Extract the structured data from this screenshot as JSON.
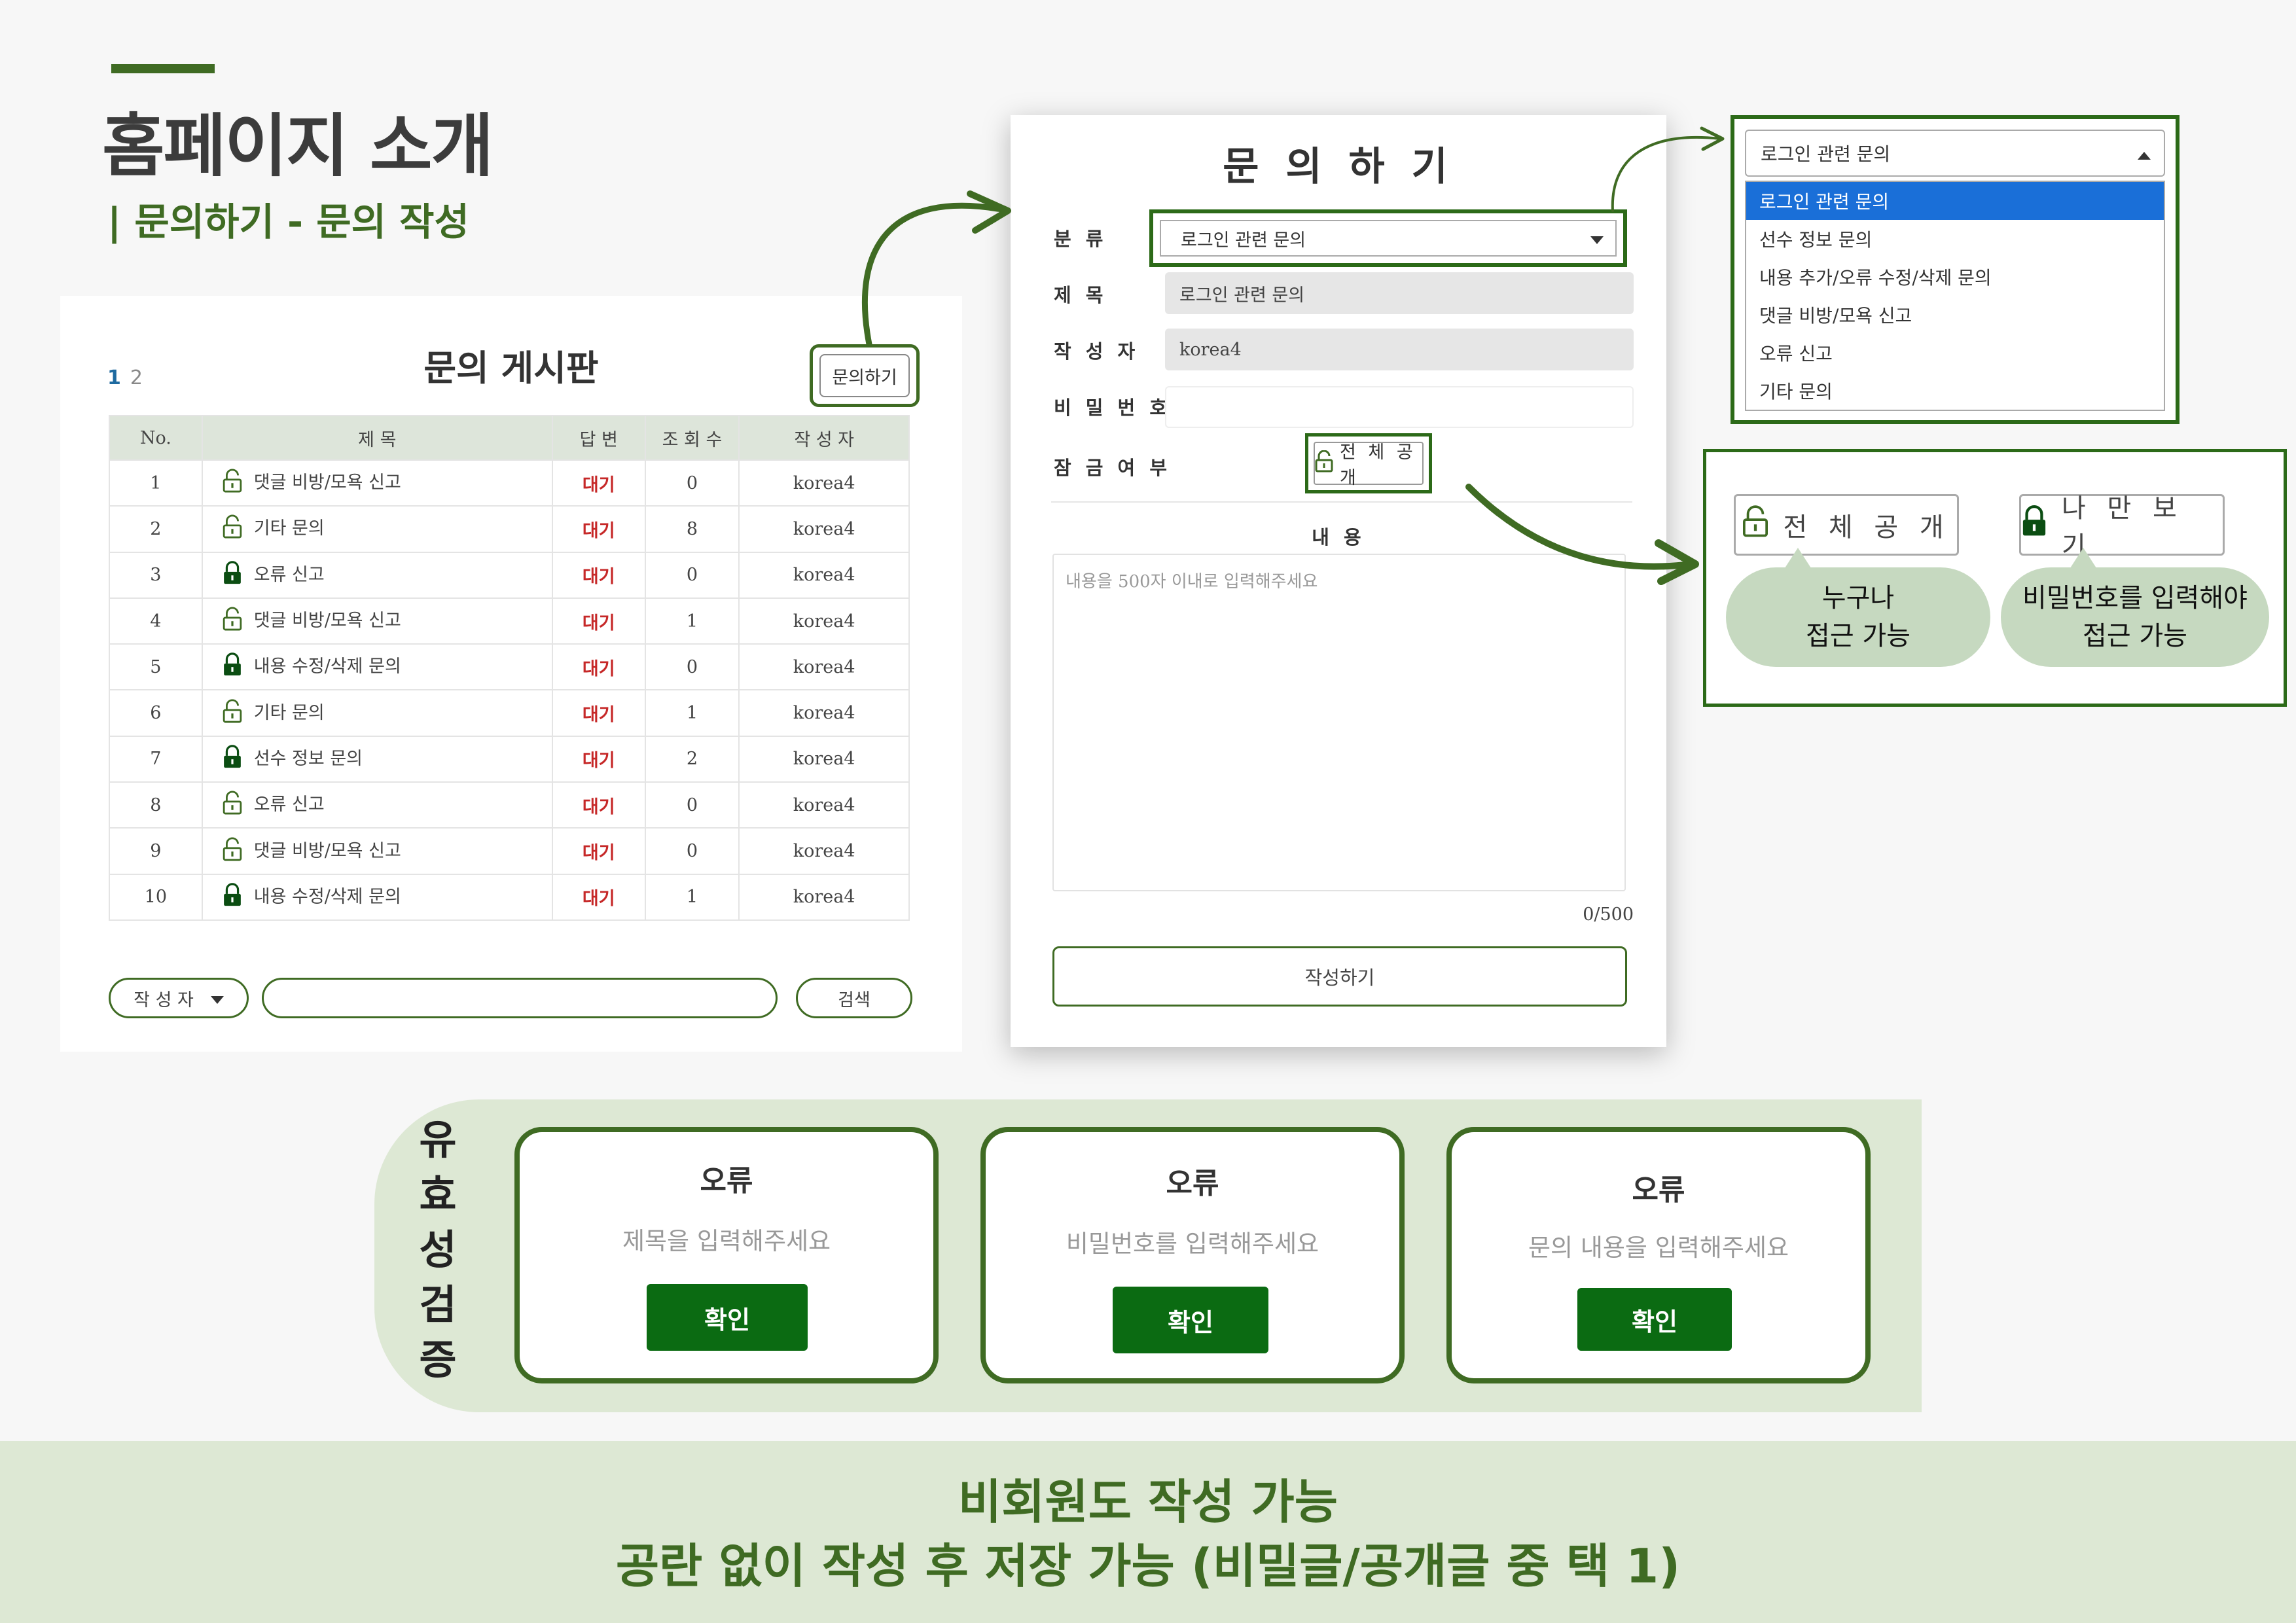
{
  "heading": {
    "title": "홈페이지 소개",
    "subtitle": "| 문의하기 - 문의 작성"
  },
  "board": {
    "pages": [
      "1",
      "2"
    ],
    "title": "문의 게시판",
    "inquiry_button": "문의하기",
    "columns": [
      "No.",
      "제 목",
      "답 변",
      "조 회 수",
      "작 성 자"
    ],
    "rows": [
      {
        "no": "1",
        "title": "댓글 비방/모욕 신고",
        "locked": false,
        "answer": "대기",
        "views": "0",
        "author": "korea4"
      },
      {
        "no": "2",
        "title": "기타 문의",
        "locked": false,
        "answer": "대기",
        "views": "8",
        "author": "korea4"
      },
      {
        "no": "3",
        "title": "오류 신고",
        "locked": true,
        "answer": "대기",
        "views": "0",
        "author": "korea4"
      },
      {
        "no": "4",
        "title": "댓글 비방/모욕 신고",
        "locked": false,
        "answer": "대기",
        "views": "1",
        "author": "korea4"
      },
      {
        "no": "5",
        "title": "내용 수정/삭제 문의",
        "locked": true,
        "answer": "대기",
        "views": "0",
        "author": "korea4"
      },
      {
        "no": "6",
        "title": "기타 문의",
        "locked": false,
        "answer": "대기",
        "views": "1",
        "author": "korea4"
      },
      {
        "no": "7",
        "title": "선수 정보 문의",
        "locked": true,
        "answer": "대기",
        "views": "2",
        "author": "korea4"
      },
      {
        "no": "8",
        "title": "오류 신고",
        "locked": false,
        "answer": "대기",
        "views": "0",
        "author": "korea4"
      },
      {
        "no": "9",
        "title": "댓글 비방/모욕 신고",
        "locked": false,
        "answer": "대기",
        "views": "0",
        "author": "korea4"
      },
      {
        "no": "10",
        "title": "내용 수정/삭제 문의",
        "locked": true,
        "answer": "대기",
        "views": "1",
        "author": "korea4"
      }
    ],
    "search_select": "작 성 자",
    "search_input": "",
    "search_button": "검색"
  },
  "form": {
    "title": "문 의 하 기",
    "category_label": "분 류",
    "category_value": "로그인 관련 문의",
    "subject_label": "제 목",
    "subject_value": "로그인 관련 문의",
    "author_label": "작 성 자",
    "author_value": "korea4",
    "password_label": "비 밀 번 호",
    "password_value": "",
    "lock_label": "잠 금 여 부",
    "lock_value": "전 체 공 개",
    "content_label": "내 용",
    "content_placeholder": "내용을 500자 이내로 입력해주세요",
    "counter": "0/500",
    "submit": "작성하기"
  },
  "dropdown": {
    "selected": "로그인 관련 문의",
    "options": [
      "로그인 관련 문의",
      "선수 정보 문의",
      "내용 추가/오류 수정/삭제 문의",
      "댓글 비방/모욕 신고",
      "오류 신고",
      "기타 문의"
    ]
  },
  "lock_options": {
    "public_label": "전 체 공 개",
    "private_label": "나 만 보 기",
    "public_desc_1": "누구나",
    "public_desc_2": "접근 가능",
    "private_desc_1": "비밀번호를 입력해야",
    "private_desc_2": "접근 가능"
  },
  "validation": {
    "label": "유효성검증",
    "cards": [
      {
        "title": "오류",
        "message": "제목을 입력해주세요",
        "button": "확인"
      },
      {
        "title": "오류",
        "message": "비밀번호를 입력해주세요",
        "button": "확인"
      },
      {
        "title": "오류",
        "message": "문의 내용을 입력해주세요",
        "button": "확인"
      }
    ]
  },
  "banner": {
    "line1": "비회원도 작성 가능",
    "line2": "공란 없이 작성 후 저장 가능 (비밀글/공개글 중 택 1)"
  },
  "colors": {
    "accent": "#3f6b23",
    "wait": "#c62828",
    "confirm": "#0b6b12",
    "selected_option": "#1a6fd8"
  }
}
